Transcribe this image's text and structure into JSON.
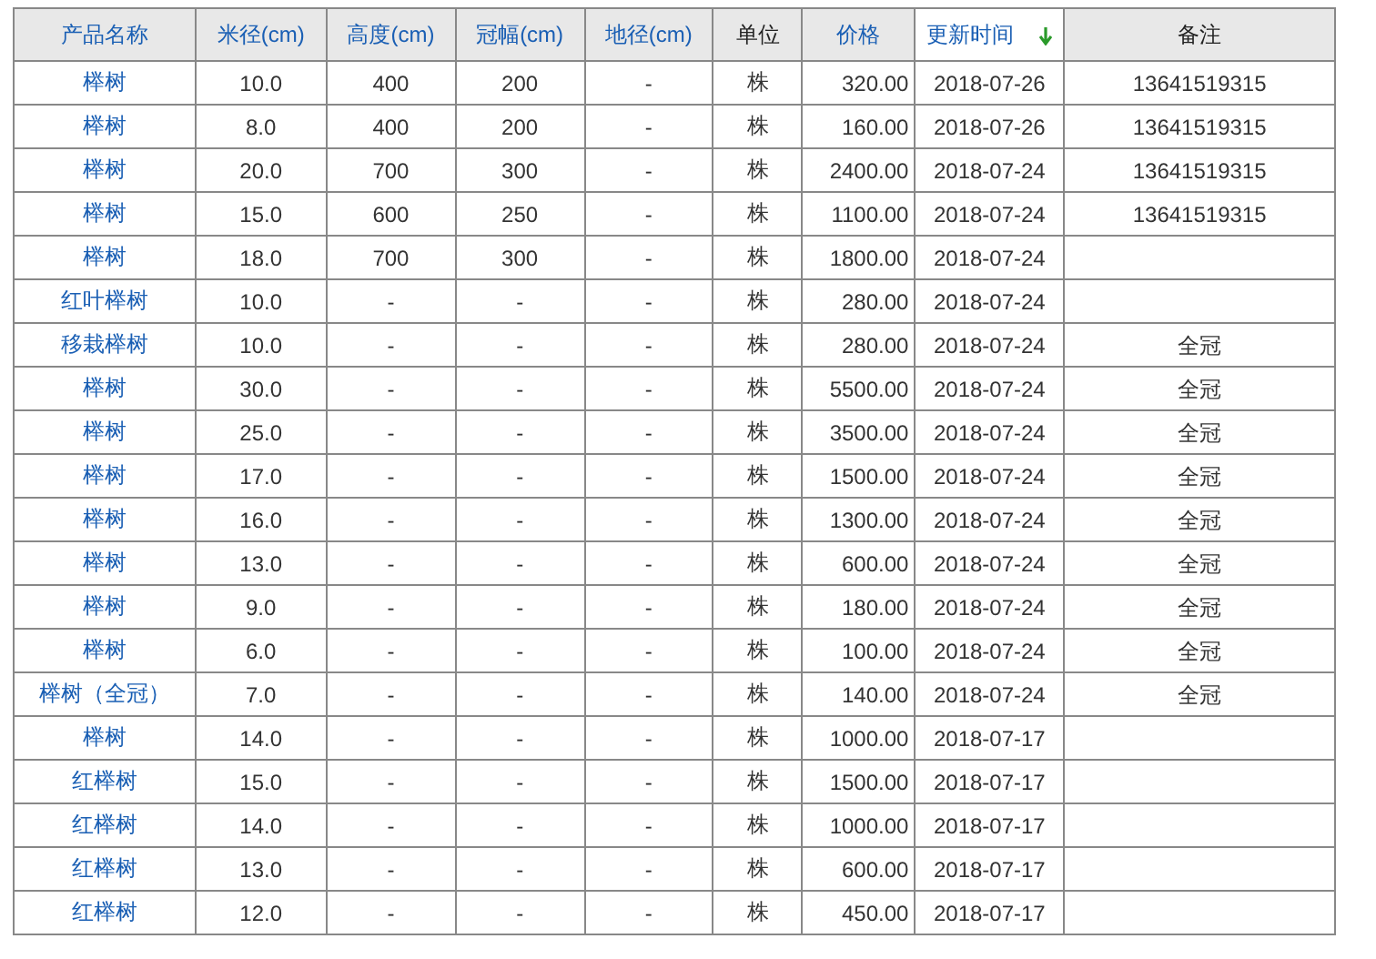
{
  "table": {
    "columns": [
      {
        "label": "产品名称",
        "sortable": true,
        "sorted": false
      },
      {
        "label": "米径(cm)",
        "sortable": true,
        "sorted": false
      },
      {
        "label": "高度(cm)",
        "sortable": true,
        "sorted": false
      },
      {
        "label": "冠幅(cm)",
        "sortable": true,
        "sorted": false
      },
      {
        "label": "地径(cm)",
        "sortable": true,
        "sorted": false
      },
      {
        "label": "单位",
        "sortable": false,
        "sorted": false
      },
      {
        "label": "价格",
        "sortable": true,
        "sorted": false
      },
      {
        "label": "更新时间",
        "sortable": true,
        "sorted": true
      },
      {
        "label": "备注",
        "sortable": false,
        "sorted": false
      }
    ],
    "rows": [
      [
        "榉树",
        "10.0",
        "400",
        "200",
        "-",
        "株",
        "320.00",
        "2018-07-26",
        "13641519315"
      ],
      [
        "榉树",
        "8.0",
        "400",
        "200",
        "-",
        "株",
        "160.00",
        "2018-07-26",
        "13641519315"
      ],
      [
        "榉树",
        "20.0",
        "700",
        "300",
        "-",
        "株",
        "2400.00",
        "2018-07-24",
        "13641519315"
      ],
      [
        "榉树",
        "15.0",
        "600",
        "250",
        "-",
        "株",
        "1100.00",
        "2018-07-24",
        "13641519315"
      ],
      [
        "榉树",
        "18.0",
        "700",
        "300",
        "-",
        "株",
        "1800.00",
        "2018-07-24",
        ""
      ],
      [
        "红叶榉树",
        "10.0",
        "-",
        "-",
        "-",
        "株",
        "280.00",
        "2018-07-24",
        ""
      ],
      [
        "移栽榉树",
        "10.0",
        "-",
        "-",
        "-",
        "株",
        "280.00",
        "2018-07-24",
        "全冠"
      ],
      [
        "榉树",
        "30.0",
        "-",
        "-",
        "-",
        "株",
        "5500.00",
        "2018-07-24",
        "全冠"
      ],
      [
        "榉树",
        "25.0",
        "-",
        "-",
        "-",
        "株",
        "3500.00",
        "2018-07-24",
        "全冠"
      ],
      [
        "榉树",
        "17.0",
        "-",
        "-",
        "-",
        "株",
        "1500.00",
        "2018-07-24",
        "全冠"
      ],
      [
        "榉树",
        "16.0",
        "-",
        "-",
        "-",
        "株",
        "1300.00",
        "2018-07-24",
        "全冠"
      ],
      [
        "榉树",
        "13.0",
        "-",
        "-",
        "-",
        "株",
        "600.00",
        "2018-07-24",
        "全冠"
      ],
      [
        "榉树",
        "9.0",
        "-",
        "-",
        "-",
        "株",
        "180.00",
        "2018-07-24",
        "全冠"
      ],
      [
        "榉树",
        "6.0",
        "-",
        "-",
        "-",
        "株",
        "100.00",
        "2018-07-24",
        "全冠"
      ],
      [
        "榉树（全冠）",
        "7.0",
        "-",
        "-",
        "-",
        "株",
        "140.00",
        "2018-07-24",
        "全冠"
      ],
      [
        "榉树",
        "14.0",
        "-",
        "-",
        "-",
        "株",
        "1000.00",
        "2018-07-17",
        ""
      ],
      [
        "红榉树",
        "15.0",
        "-",
        "-",
        "-",
        "株",
        "1500.00",
        "2018-07-17",
        ""
      ],
      [
        "红榉树",
        "14.0",
        "-",
        "-",
        "-",
        "株",
        "1000.00",
        "2018-07-17",
        ""
      ],
      [
        "红榉树",
        "13.0",
        "-",
        "-",
        "-",
        "株",
        "600.00",
        "2018-07-17",
        ""
      ],
      [
        "红榉树",
        "12.0",
        "-",
        "-",
        "-",
        "株",
        "450.00",
        "2018-07-17",
        ""
      ]
    ]
  }
}
